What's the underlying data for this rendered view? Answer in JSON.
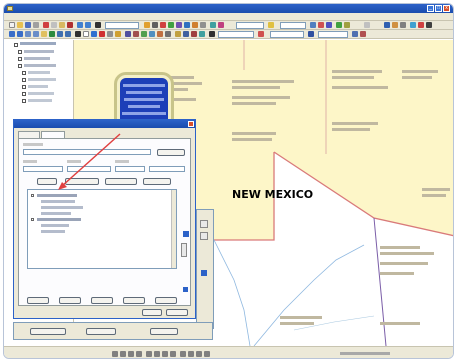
{
  "window": {
    "title": "",
    "min_label": "_",
    "max_label": "□",
    "close_label": "x"
  },
  "menu": {
    "items": [
      "",
      "",
      "",
      "",
      "",
      "",
      "",
      ""
    ]
  },
  "map": {
    "state_label": "NEW MEXICO",
    "colors": {
      "fill": "#fdf6c8",
      "boundary": "#d97a7a",
      "county_line": "#7b5ea8",
      "road": "#8fb8e0"
    }
  },
  "callout": {
    "lines": [
      "",
      "",
      "",
      "",
      "",
      ""
    ],
    "colors": {
      "fill": "#1d3fb8",
      "border": "#c8c48a"
    }
  },
  "label_dialog": {
    "title": "",
    "tabs": [
      "",
      ""
    ],
    "buttons": [
      "",
      "",
      "",
      "",
      ""
    ],
    "tree_items": [
      "",
      "",
      "",
      "",
      "",
      "",
      "",
      "",
      ""
    ]
  }
}
